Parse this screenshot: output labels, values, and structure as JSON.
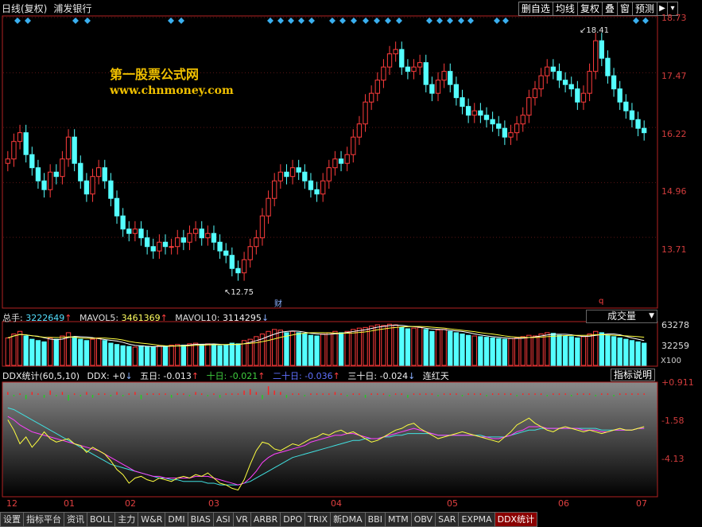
{
  "header": {
    "period_label": "日线(复权)",
    "stock_name": "浦发银行",
    "toolbar": [
      "删自选",
      "均线",
      "复权",
      "叠",
      "窗",
      "预测"
    ],
    "icons": [
      "pin-arrow-icon",
      "dropdown-icon"
    ]
  },
  "watermark": {
    "line1": "第一股票公式网",
    "line2": "www.chnmoney.com",
    "color": "#f0c000"
  },
  "colors": {
    "up": "#ff3c3c",
    "down": "#54ffff",
    "frame": "#b22222",
    "ma5": "#ffffff",
    "ma10": "#ffff40",
    "ddx_bar_up": "#ff2020",
    "ddx_bar_dn": "#20d020",
    "ddx_line1": "#ffff40",
    "ddx_line2": "#ff40ff",
    "ddx_line3": "#40e0e0"
  },
  "price_axis": {
    "labels": [
      "18.73",
      "17.47",
      "16.22",
      "14.96",
      "13.71"
    ],
    "values": [
      18.73,
      17.47,
      16.22,
      14.96,
      13.71
    ],
    "min": 12.55,
    "max": 18.73
  },
  "markers": {
    "high": "18.41",
    "low": "12.75",
    "fin": "财",
    "q": "q"
  },
  "volume": {
    "label_total": "总手:",
    "total": "3222649",
    "label_ma5": "MAVOL5:",
    "ma5": "3461369",
    "label_ma10": "MAVOL10:",
    "ma10": "3114295",
    "axis": [
      "63278",
      "32259"
    ],
    "axis_values": [
      63278,
      32259
    ],
    "unit": "X100",
    "select_label": "成交量"
  },
  "ddx": {
    "title": "DDX统计(60,5,10)",
    "label_ddx": "DDX:",
    "ddx": "+0",
    "label_d5": "五日:",
    "d5": "-0.013",
    "label_d10": "十日:",
    "d10": "-0.021",
    "label_d20": "二十日:",
    "d20": "-0.036",
    "label_d30": "三十日:",
    "d30": "-0.024",
    "label_streak": "连红天",
    "help": "指标说明",
    "axis": [
      "+0.911",
      "-1.58",
      "-4.13"
    ],
    "axis_values": [
      0.911,
      -1.58,
      -4.13
    ]
  },
  "x_axis": {
    "labels": [
      "12",
      "01",
      "02",
      "03",
      "04",
      "05",
      "06",
      "07"
    ]
  },
  "tabs": [
    "设置",
    "指标平台",
    "资讯",
    "BOLL",
    "主力",
    "W&R",
    "DMI",
    "BIAS",
    "ASI",
    "VR",
    "ARBR",
    "DPO",
    "TRIX",
    "新DMA",
    "BBI",
    "MTM",
    "OBV",
    "SAR",
    "EXPMA",
    "DDX统计"
  ],
  "chart_data": {
    "type": "candlestick",
    "ylim": [
      12.55,
      18.73
    ],
    "price": [
      15.5,
      15.9,
      16.1,
      15.6,
      15.3,
      15.0,
      14.8,
      15.2,
      15.1,
      15.5,
      16.0,
      15.4,
      15.0,
      14.7,
      15.1,
      15.3,
      15.0,
      14.6,
      14.2,
      13.9,
      13.8,
      13.9,
      13.7,
      13.5,
      13.4,
      13.6,
      13.5,
      13.5,
      13.7,
      13.6,
      13.8,
      13.9,
      13.7,
      13.8,
      13.6,
      13.4,
      13.3,
      13.0,
      12.9,
      13.2,
      13.5,
      13.7,
      14.2,
      14.6,
      15.0,
      15.2,
      15.1,
      15.3,
      15.2,
      15.0,
      14.8,
      14.7,
      15.0,
      15.3,
      15.5,
      15.4,
      15.6,
      16.0,
      16.3,
      16.8,
      17.0,
      17.3,
      17.6,
      17.9,
      18.0,
      17.6,
      17.5,
      17.6,
      17.7,
      17.2,
      17.0,
      17.3,
      17.5,
      17.2,
      16.9,
      16.7,
      16.5,
      16.6,
      16.5,
      16.4,
      16.3,
      16.2,
      16.0,
      16.1,
      16.3,
      16.5,
      16.9,
      17.1,
      17.4,
      17.6,
      17.5,
      17.3,
      17.2,
      17.1,
      16.8,
      17.0,
      17.5,
      18.2,
      17.8,
      17.4,
      17.1,
      16.8,
      16.6,
      16.4,
      16.2,
      16.1
    ],
    "volume": [
      42000,
      48000,
      52000,
      45000,
      40000,
      38000,
      36000,
      42000,
      40000,
      45000,
      50000,
      44000,
      40000,
      38000,
      40000,
      42000,
      38000,
      34000,
      32000,
      30000,
      29000,
      28000,
      30000,
      29000,
      28000,
      30000,
      29000,
      31000,
      32000,
      31000,
      33000,
      34000,
      32000,
      33000,
      32000,
      30000,
      31000,
      34000,
      33000,
      38000,
      40000,
      44000,
      48000,
      52000,
      55000,
      54000,
      50000,
      52000,
      50000,
      48000,
      46000,
      45000,
      48000,
      50000,
      52000,
      50000,
      52000,
      55000,
      57000,
      58000,
      60000,
      62000,
      61000,
      63000,
      62000,
      58000,
      56000,
      57000,
      58000,
      55000,
      52000,
      54000,
      55000,
      52000,
      50000,
      48000,
      46000,
      45000,
      44000,
      43000,
      42000,
      41000,
      40000,
      41000,
      42000,
      44000,
      46000,
      45000,
      48000,
      50000,
      49000,
      46000,
      45000,
      44000,
      42000,
      44000,
      48000,
      52000,
      50000,
      46000,
      44000,
      42000,
      40000,
      38000,
      36000,
      34000
    ],
    "ddx": [
      0.2,
      -0.1,
      0.1,
      -0.3,
      0.2,
      0.1,
      -0.2,
      0.3,
      -0.1,
      0.2,
      -0.4,
      0.1,
      -0.1,
      0.2,
      -0.2,
      0.1,
      0.1,
      -0.1,
      0.2,
      -0.1,
      0.1,
      0.2,
      -0.3,
      0.1,
      0.1,
      0.1,
      0.1,
      -0.2,
      0.1,
      0.1,
      -0.1,
      0.2,
      0.1,
      -0.1,
      0.1,
      -0.2,
      0.1,
      0.1,
      0.1,
      0.3,
      0.4,
      0.2,
      -0.3,
      0.6,
      0.3,
      0.2,
      -0.2,
      0.1,
      0.1,
      -0.1,
      0.1,
      0.1,
      0.1,
      0.1,
      0.2,
      0.1,
      -0.1,
      0.1,
      0.1,
      -0.2,
      0.1,
      0.1,
      0.1,
      -0.1,
      0.1,
      0.1,
      -0.2,
      0.1,
      0.1,
      0.1,
      0.1,
      -0.1,
      0.1,
      0.1,
      0.1,
      -0.1,
      0.1,
      0.1,
      0.1,
      -0.1,
      0.1,
      0.1,
      0.1,
      0.1,
      -0.1,
      0.1,
      0.1,
      0.1,
      0.1,
      -0.1,
      0.1,
      0.1,
      0.1,
      -0.1,
      0.1,
      0.1,
      0.1,
      -0.1,
      0.1,
      0.1,
      -0.1,
      0.1,
      0.1,
      0.1,
      0.1,
      0.1
    ],
    "ddx_line1": [
      -1.2,
      -1.8,
      -2.6,
      -2.2,
      -2.8,
      -2.4,
      -1.9,
      -2.3,
      -2.5,
      -2.4,
      -2.3,
      -2.6,
      -2.7,
      -3.1,
      -2.8,
      -3.0,
      -3.2,
      -3.6,
      -4.1,
      -4.4,
      -4.9,
      -4.6,
      -4.5,
      -4.7,
      -4.8,
      -4.6,
      -4.7,
      -4.8,
      -4.6,
      -4.5,
      -4.6,
      -4.4,
      -4.5,
      -4.3,
      -4.6,
      -4.9,
      -5.0,
      -5.2,
      -5.3,
      -4.7,
      -3.8,
      -3.0,
      -2.5,
      -2.6,
      -2.9,
      -3.0,
      -2.8,
      -2.6,
      -2.7,
      -2.5,
      -2.3,
      -2.2,
      -2.0,
      -2.1,
      -1.9,
      -1.8,
      -2.0,
      -1.9,
      -2.1,
      -2.3,
      -2.5,
      -2.4,
      -2.2,
      -2.0,
      -1.8,
      -1.7,
      -1.5,
      -1.4,
      -1.7,
      -1.9,
      -2.1,
      -2.3,
      -2.2,
      -2.1,
      -2.0,
      -1.9,
      -2.0,
      -2.1,
      -2.2,
      -2.3,
      -2.4,
      -2.5,
      -2.2,
      -1.9,
      -1.5,
      -1.3,
      -1.1,
      -1.4,
      -1.6,
      -1.8,
      -1.9,
      -1.7,
      -1.6,
      -1.7,
      -1.8,
      -1.9,
      -1.8,
      -1.9,
      -2.0,
      -1.9,
      -1.8,
      -1.7,
      -1.8,
      -1.8,
      -1.7,
      -1.6
    ],
    "ddx_line2": [
      -1.0,
      -1.2,
      -1.5,
      -1.7,
      -1.9,
      -2.0,
      -2.1,
      -2.2,
      -2.3,
      -2.4,
      -2.5,
      -2.6,
      -2.7,
      -2.8,
      -2.9,
      -3.0,
      -3.2,
      -3.4,
      -3.6,
      -3.8,
      -4.0,
      -4.2,
      -4.3,
      -4.4,
      -4.5,
      -4.5,
      -4.6,
      -4.6,
      -4.6,
      -4.6,
      -4.6,
      -4.5,
      -4.5,
      -4.5,
      -4.6,
      -4.7,
      -4.8,
      -4.9,
      -5.0,
      -4.9,
      -4.6,
      -4.2,
      -3.7,
      -3.4,
      -3.2,
      -3.1,
      -3.0,
      -2.9,
      -2.8,
      -2.7,
      -2.5,
      -2.4,
      -2.3,
      -2.2,
      -2.1,
      -2.1,
      -2.0,
      -2.0,
      -2.1,
      -2.2,
      -2.3,
      -2.3,
      -2.2,
      -2.1,
      -2.0,
      -1.9,
      -1.8,
      -1.7,
      -1.8,
      -1.9,
      -2.0,
      -2.1,
      -2.1,
      -2.1,
      -2.1,
      -2.1,
      -2.1,
      -2.1,
      -2.2,
      -2.2,
      -2.3,
      -2.3,
      -2.2,
      -2.1,
      -1.9,
      -1.8,
      -1.6,
      -1.6,
      -1.6,
      -1.7,
      -1.7,
      -1.7,
      -1.7,
      -1.7,
      -1.7,
      -1.8,
      -1.8,
      -1.8,
      -1.9,
      -1.9,
      -1.8,
      -1.8,
      -1.8,
      -1.8,
      -1.7,
      -1.7
    ],
    "ddx_line3": [
      -0.5,
      -0.6,
      -0.8,
      -1.0,
      -1.2,
      -1.4,
      -1.6,
      -1.8,
      -2.0,
      -2.2,
      -2.4,
      -2.6,
      -2.8,
      -3.0,
      -3.2,
      -3.4,
      -3.6,
      -3.8,
      -3.9,
      -4.0,
      -4.1,
      -4.2,
      -4.3,
      -4.4,
      -4.5,
      -4.6,
      -4.6,
      -4.7,
      -4.7,
      -4.8,
      -4.8,
      -4.8,
      -4.8,
      -4.9,
      -4.9,
      -5.0,
      -5.0,
      -5.0,
      -5.0,
      -4.9,
      -4.8,
      -4.6,
      -4.4,
      -4.2,
      -4.0,
      -3.8,
      -3.6,
      -3.4,
      -3.3,
      -3.2,
      -3.1,
      -3.0,
      -2.9,
      -2.8,
      -2.7,
      -2.6,
      -2.5,
      -2.4,
      -2.4,
      -2.3,
      -2.3,
      -2.3,
      -2.2,
      -2.2,
      -2.1,
      -2.1,
      -2.0,
      -2.0,
      -2.0,
      -2.0,
      -2.0,
      -2.1,
      -2.1,
      -2.1,
      -2.1,
      -2.1,
      -2.1,
      -2.1,
      -2.1,
      -2.2,
      -2.2,
      -2.2,
      -2.2,
      -2.1,
      -2.0,
      -1.9,
      -1.8,
      -1.8,
      -1.7,
      -1.7,
      -1.7,
      -1.7,
      -1.7,
      -1.7,
      -1.7,
      -1.7,
      -1.7,
      -1.7,
      -1.8,
      -1.8,
      -1.8,
      -1.8,
      -1.8,
      -1.8,
      -1.7,
      -1.7
    ],
    "ddx_ylim": [
      -5.6,
      0.911
    ]
  }
}
